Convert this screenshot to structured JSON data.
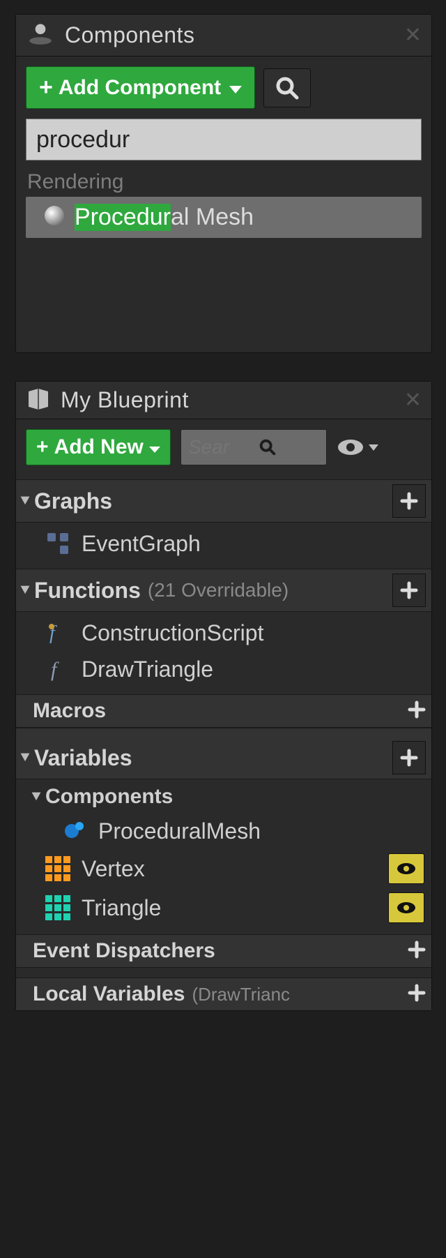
{
  "componentsPanel": {
    "title": "Components",
    "addButton": "Add Component",
    "searchValue": "procedur",
    "results": {
      "groupLabel": "Rendering",
      "highlight": "Procedur",
      "rest": "al Mesh"
    }
  },
  "blueprintPanel": {
    "title": "My Blueprint",
    "addButton": "Add New",
    "searchPlaceholder": "Sear",
    "sections": {
      "graphs": {
        "label": "Graphs"
      },
      "functions": {
        "label": "Functions",
        "extra": "(21 Overridable)"
      },
      "macros": {
        "label": "Macros"
      },
      "variables": {
        "label": "Variables"
      },
      "components": {
        "label": "Components"
      },
      "eventDispatchers": {
        "label": "Event Dispatchers"
      },
      "localVariables": {
        "label": "Local Variables",
        "extra": "(DrawTrianc"
      }
    },
    "items": {
      "eventGraph": "EventGraph",
      "constructionScript": "ConstructionScript",
      "drawTriangle": "DrawTriangle",
      "proceduralMesh": "ProceduralMesh",
      "vertex": "Vertex",
      "triangle": "Triangle"
    }
  }
}
